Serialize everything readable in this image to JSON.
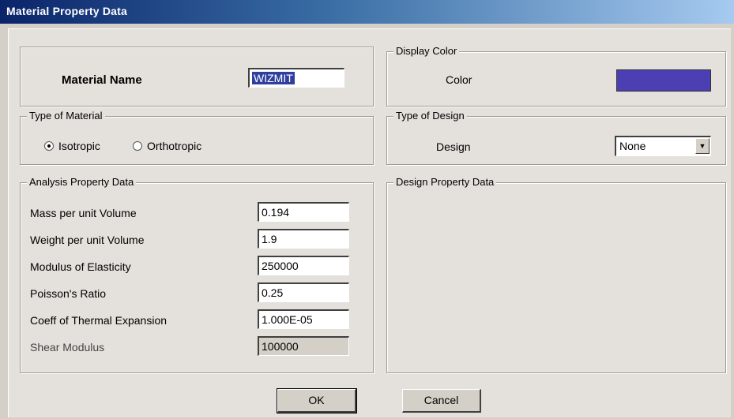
{
  "window": {
    "title": "Material Property Data"
  },
  "material_name": {
    "label": "Material Name",
    "value": "WIZMIT"
  },
  "display_color": {
    "group_label": "Display Color",
    "color_label": "Color",
    "color_value": "#4b3fb3"
  },
  "type_of_material": {
    "group_label": "Type of Material",
    "options": [
      {
        "label": "Isotropic",
        "selected": true
      },
      {
        "label": "Orthotropic",
        "selected": false
      }
    ]
  },
  "type_of_design": {
    "group_label": "Type of Design",
    "design_label": "Design",
    "design_value": "None"
  },
  "analysis": {
    "group_label": "Analysis Property Data",
    "rows": [
      {
        "label": "Mass per unit Volume",
        "value": "0.194"
      },
      {
        "label": "Weight per unit Volume",
        "value": "1.9"
      },
      {
        "label": "Modulus of Elasticity",
        "value": "250000"
      },
      {
        "label": "Poisson's Ratio",
        "value": "0.25"
      },
      {
        "label": "Coeff of Thermal Expansion",
        "value": "1.000E-05"
      },
      {
        "label": "Shear Modulus",
        "value": "100000"
      }
    ]
  },
  "design_property": {
    "group_label": "Design Property Data"
  },
  "buttons": {
    "ok": "OK",
    "cancel": "Cancel"
  }
}
